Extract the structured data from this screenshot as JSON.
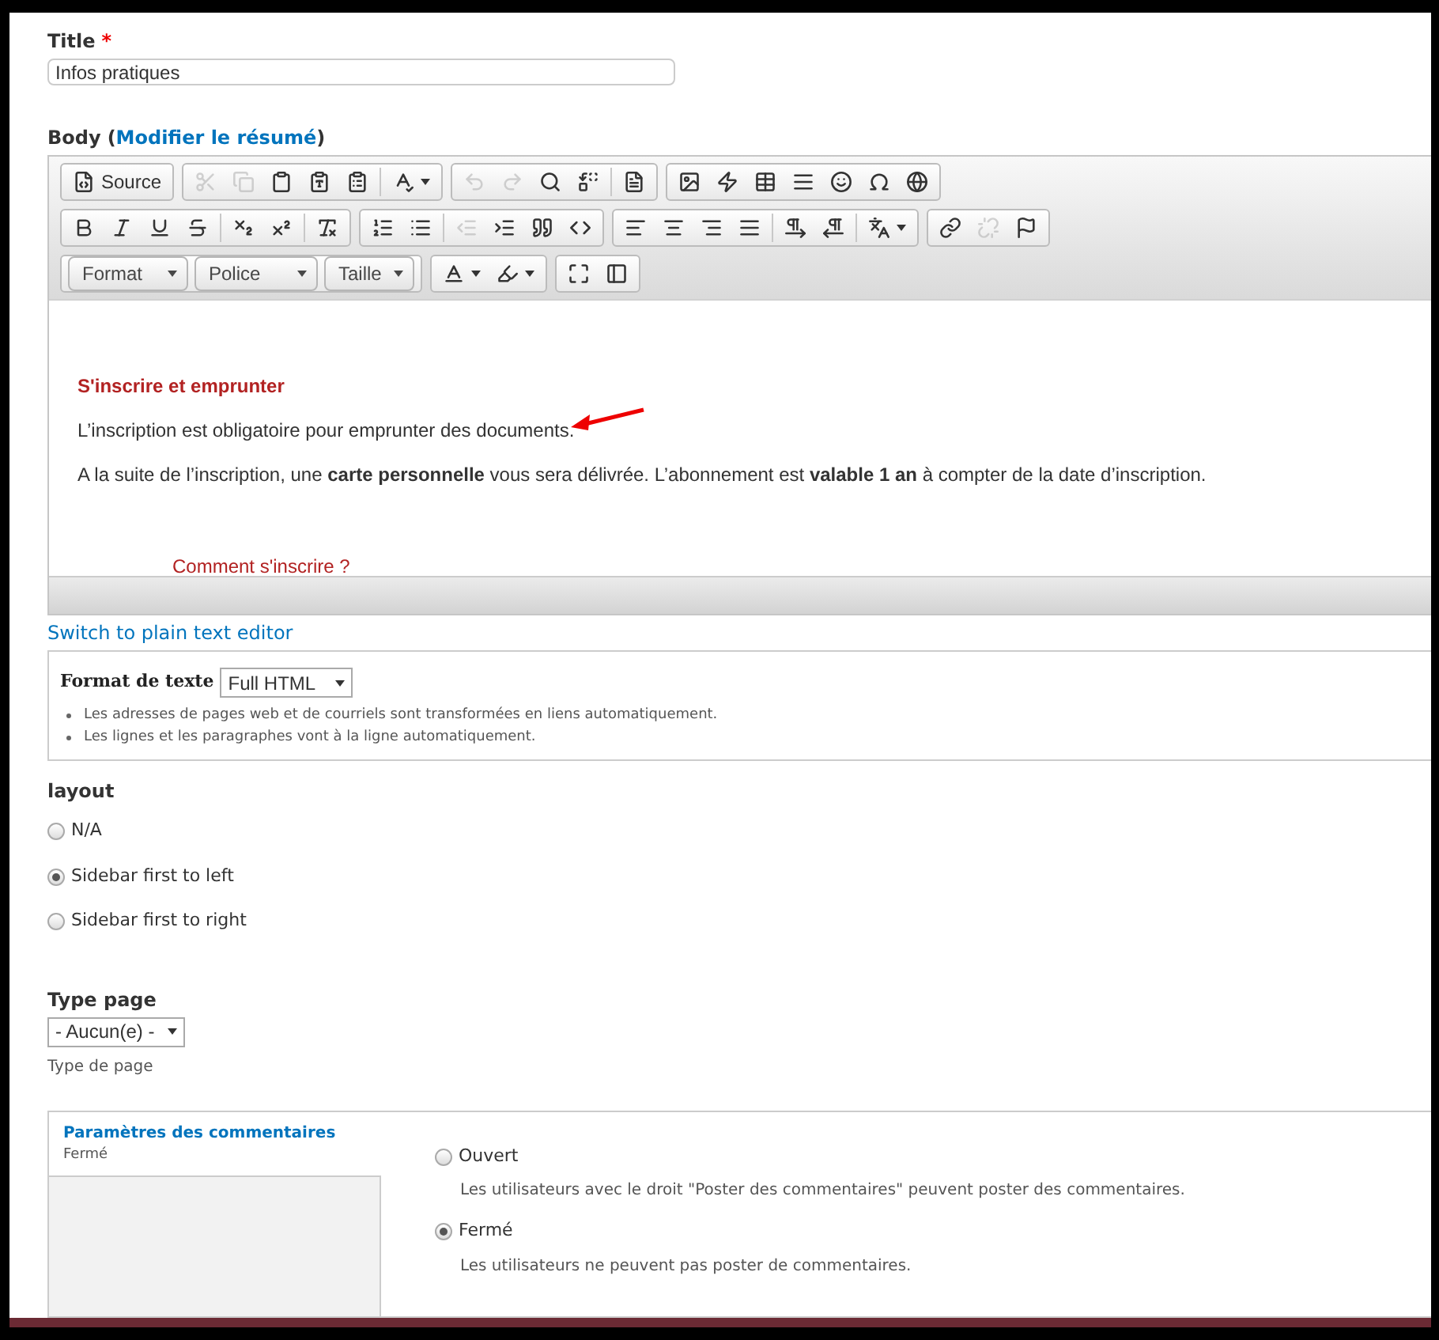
{
  "title_field": {
    "label": "Title",
    "required_mark": "*",
    "value": "Infos pratiques"
  },
  "body_field": {
    "label": "Body",
    "summary_open": "(",
    "summary_link": "Modifier le résumé",
    "summary_close": ")",
    "toolbar": [
      [
        [
          {
            "kind": "source",
            "label": "Source",
            "disabled": false
          }
        ],
        [
          {
            "kind": "cut",
            "disabled": true
          },
          {
            "kind": "copy",
            "disabled": true
          },
          {
            "kind": "paste",
            "disabled": false
          },
          {
            "kind": "paste-text",
            "disabled": false
          },
          {
            "kind": "paste-word",
            "disabled": false
          },
          {
            "kind": "sep"
          },
          {
            "kind": "spellcheck",
            "disabled": false,
            "menu": true
          }
        ],
        [
          {
            "kind": "undo",
            "disabled": true
          },
          {
            "kind": "redo",
            "disabled": true
          },
          {
            "kind": "find",
            "disabled": false
          },
          {
            "kind": "replace",
            "disabled": false
          },
          {
            "kind": "sep"
          },
          {
            "kind": "templates",
            "disabled": false
          }
        ],
        [
          {
            "kind": "image",
            "disabled": false
          },
          {
            "kind": "flash",
            "disabled": false
          },
          {
            "kind": "table",
            "disabled": false
          },
          {
            "kind": "rule",
            "disabled": false
          },
          {
            "kind": "smiley",
            "disabled": false
          },
          {
            "kind": "omega",
            "disabled": false
          },
          {
            "kind": "globe",
            "disabled": false
          }
        ]
      ],
      [
        [
          {
            "kind": "bold",
            "disabled": false
          },
          {
            "kind": "italic",
            "disabled": false
          },
          {
            "kind": "underline",
            "disabled": false
          },
          {
            "kind": "strike",
            "disabled": false
          },
          {
            "kind": "sep"
          },
          {
            "kind": "subscript",
            "disabled": false
          },
          {
            "kind": "superscript",
            "disabled": false
          },
          {
            "kind": "sep"
          },
          {
            "kind": "remove-format",
            "disabled": false
          }
        ],
        [
          {
            "kind": "numbered-list",
            "disabled": false
          },
          {
            "kind": "bullet-list",
            "disabled": false
          },
          {
            "kind": "sep"
          },
          {
            "kind": "outdent",
            "disabled": true
          },
          {
            "kind": "indent",
            "disabled": false
          },
          {
            "kind": "quote",
            "disabled": false
          },
          {
            "kind": "div",
            "disabled": false
          }
        ],
        [
          {
            "kind": "align-left",
            "disabled": false
          },
          {
            "kind": "align-center",
            "disabled": false
          },
          {
            "kind": "align-right",
            "disabled": false
          },
          {
            "kind": "justify",
            "disabled": false
          },
          {
            "kind": "sep"
          },
          {
            "kind": "ltr",
            "disabled": false
          },
          {
            "kind": "rtl",
            "disabled": false
          },
          {
            "kind": "sep"
          },
          {
            "kind": "language",
            "disabled": false,
            "menu": true
          }
        ],
        [
          {
            "kind": "link",
            "disabled": false
          },
          {
            "kind": "unlink",
            "disabled": true
          },
          {
            "kind": "anchor",
            "disabled": false
          }
        ]
      ],
      [
        [
          {
            "kind": "combo",
            "label": "Format",
            "disabled": false
          },
          {
            "kind": "combo",
            "label": "Police",
            "disabled": false
          },
          {
            "kind": "combo",
            "label": "Taille",
            "disabled": false
          }
        ],
        [
          {
            "kind": "text-color",
            "disabled": false,
            "menu": true
          },
          {
            "kind": "bg-color",
            "disabled": false,
            "menu": true
          }
        ],
        [
          {
            "kind": "maximize",
            "disabled": false
          },
          {
            "kind": "show-blocks",
            "disabled": false
          }
        ]
      ]
    ],
    "content": [
      {
        "kind": "heading",
        "text": "S'inscrire et emprunter"
      },
      {
        "kind": "paragraph",
        "text": "L’inscription est obligatoire pour emprunter des documents."
      },
      {
        "kind": "paragraph",
        "text": "A la suite de l’inscription, une **carte personnelle** vous sera délivrée. L’abonnement est **valable 1 an** à compter de la date d’inscription."
      },
      {
        "kind": "link",
        "text": "Comment s'inscrire ?"
      }
    ],
    "switch_link": "Switch to plain text editor",
    "text_format": {
      "label": "Format de texte",
      "value": "Full HTML",
      "tips": [
        "Les adresses de pages web et de courriels sont transformées en liens automatiquement.",
        "Les lignes et les paragraphes vont à la ligne automatiquement."
      ]
    }
  },
  "layout": {
    "label": "layout",
    "options": [
      {
        "label": "N/A",
        "selected": false
      },
      {
        "label": "Sidebar first to left",
        "selected": true
      },
      {
        "label": "Sidebar first to right",
        "selected": false
      }
    ]
  },
  "type_page": {
    "label": "Type page",
    "value": "- Aucun(e) -",
    "description": "Type de page"
  },
  "comments": {
    "tab_title": "Paramètres des commentaires",
    "tab_summary": "Fermé",
    "options": [
      {
        "label": "Ouvert",
        "description": "Les utilisateurs avec le droit \"Poster des commentaires\" peuvent poster des commentaires.",
        "selected": false
      },
      {
        "label": "Fermé",
        "description": "Les utilisateurs ne peuvent pas poster de commentaires.",
        "selected": true
      }
    ]
  }
}
